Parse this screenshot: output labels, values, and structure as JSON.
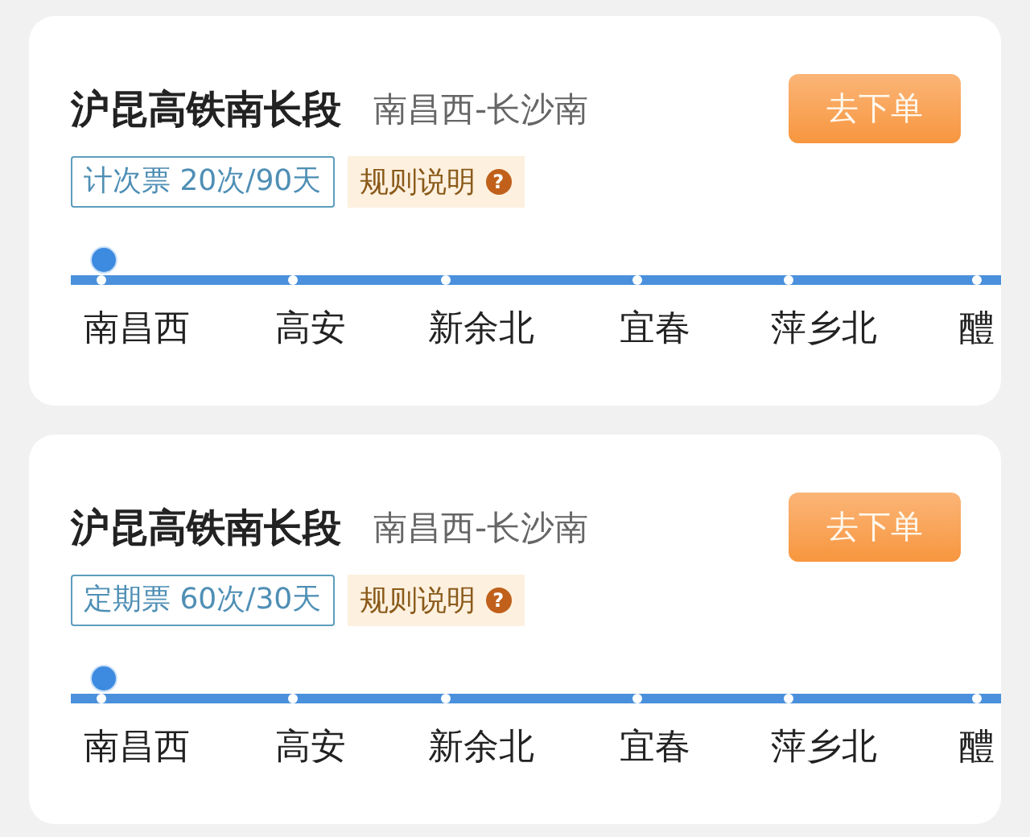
{
  "cards": [
    {
      "title": "沪昆高铁南长段",
      "route": "南昌西-长沙南",
      "order_button": "去下单",
      "ticket_tag": "计次票 20次/90天",
      "rules_link": "规则说明",
      "rules_icon": "?",
      "stations": [
        {
          "name": "南昌西",
          "selected": true
        },
        {
          "name": "高安",
          "selected": false
        },
        {
          "name": "新余北",
          "selected": false
        },
        {
          "name": "宜春",
          "selected": false
        },
        {
          "name": "萍乡北",
          "selected": false
        },
        {
          "name": "醴",
          "selected": false
        }
      ]
    },
    {
      "title": "沪昆高铁南长段",
      "route": "南昌西-长沙南",
      "order_button": "去下单",
      "ticket_tag": "定期票 60次/30天",
      "rules_link": "规则说明",
      "rules_icon": "?",
      "stations": [
        {
          "name": "南昌西",
          "selected": true
        },
        {
          "name": "高安",
          "selected": false
        },
        {
          "name": "新余北",
          "selected": false
        },
        {
          "name": "宜春",
          "selected": false
        },
        {
          "name": "萍乡北",
          "selected": false
        },
        {
          "name": "醴",
          "selected": false
        }
      ]
    }
  ]
}
